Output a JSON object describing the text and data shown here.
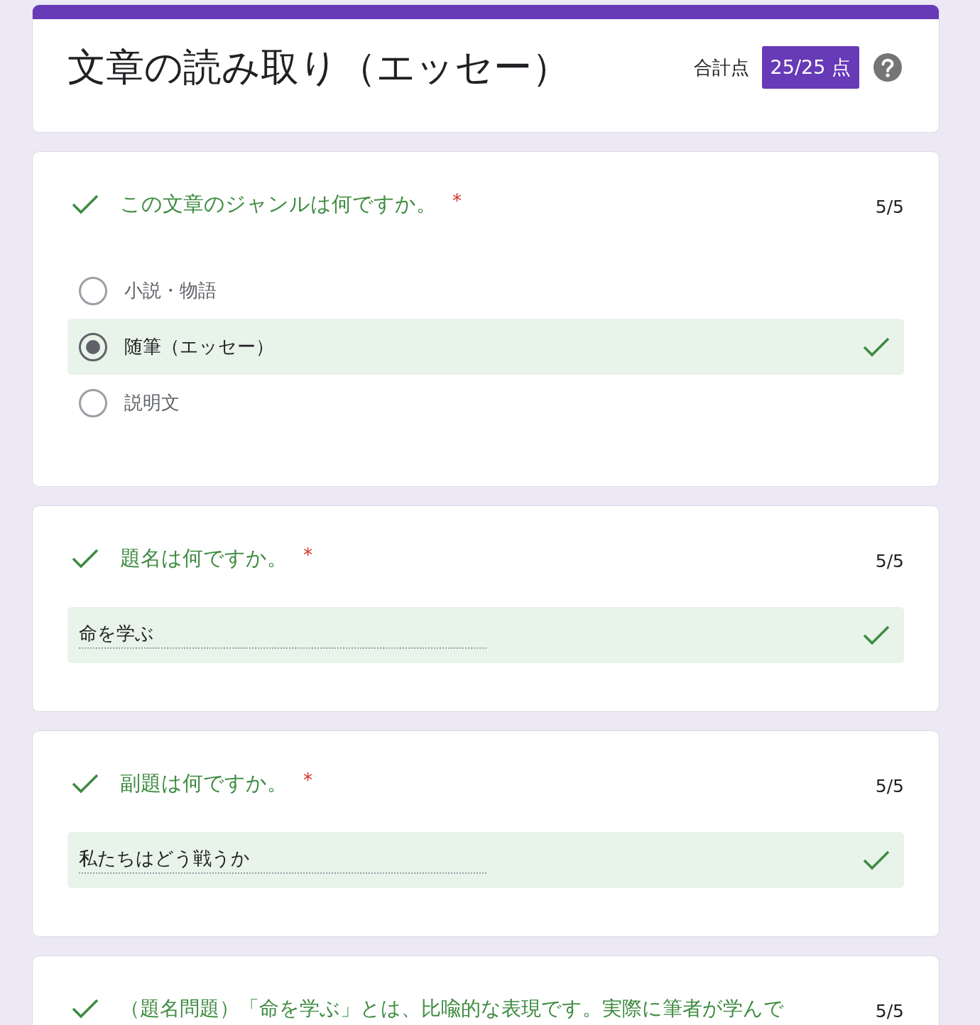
{
  "header": {
    "title": "文章の読み取り（エッセー）",
    "total_label": "合計点",
    "score": "25/25 点"
  },
  "questions": [
    {
      "kind": "choice",
      "correct": true,
      "title": "この文章のジャンルは何ですか。",
      "required_mark": "*",
      "points": "5/5",
      "options": [
        {
          "label": "小説・物語",
          "selected": false,
          "correct": false
        },
        {
          "label": "随筆（エッセー）",
          "selected": true,
          "correct": true
        },
        {
          "label": "説明文",
          "selected": false,
          "correct": false
        }
      ]
    },
    {
      "kind": "text",
      "correct": true,
      "title": "題名は何ですか。",
      "required_mark": "*",
      "points": "5/5",
      "answer": "命を学ぶ",
      "answer_correct": true
    },
    {
      "kind": "text",
      "correct": true,
      "title": "副題は何ですか。",
      "required_mark": "*",
      "points": "5/5",
      "answer": "私たちはどう戦うか",
      "answer_correct": true
    },
    {
      "kind": "header",
      "correct": true,
      "title": "（題名問題）「命を学ぶ」とは、比喩的な表現です。実際に筆者が学んで",
      "points": "5/5"
    }
  ]
}
